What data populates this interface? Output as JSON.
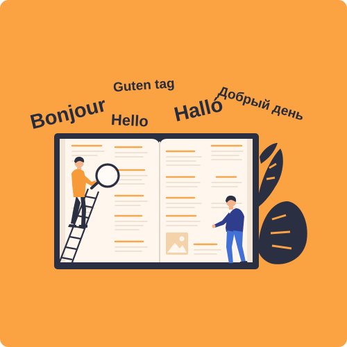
{
  "illustration": {
    "words": {
      "bonjour": "Bonjour",
      "guten_tag": "Guten tag",
      "hello": "Hello",
      "hallo": "Halló",
      "dobry_den": "Добрый день"
    },
    "icons": {
      "magnifier": "magnifying-glass-icon",
      "image": "image-placeholder-icon",
      "plant": "monstera-leaf-icon",
      "ladder": "ladder-icon"
    },
    "colors": {
      "background": "#FBA243",
      "text": "#262B3D",
      "book_frame": "#2A2F42",
      "page": "#FFF7EE",
      "page_line": "#F6A84E",
      "person_shirt": "#F69A3A",
      "person_shirt_2": "#2F3E8C",
      "pants": "#4170D6",
      "skin": "#F3B48C"
    }
  }
}
